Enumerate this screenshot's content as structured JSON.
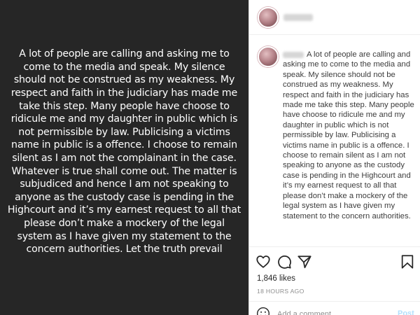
{
  "post_image": {
    "text": "A lot of people are calling and asking me to come to the media and speak. My silence should not be construed as my weakness. My respect and faith in the judiciary has made me take this step. Many people have choose to ridicule me and my daughter in public which is not permissible by law. Publicising a victims name in public is a offence. I choose to remain silent as I am not  the complainant in the case. Whatever is true shall come out. The matter is subjudiced and hence I am not speaking to anyone as the custody case is pending in the Highcourt and it’s my earnest request to all that please don’t make a mockery of the legal system as I have given my statement to the concern authorities. Let the truth prevail"
  },
  "caption": {
    "text": "A lot of people are calling and asking me to come to the media and speak. My silence should not be construed as my weakness. My respect and faith in the judiciary has made me take this step. Many people have choose to ridicule me and my daughter in public which is not permissible by law. Publicising a victims name in public is a offence. I choose to remain silent as I am not speaking to anyone as the custody case is pending in the Highcourt and it’s my earnest request to all that please don’t make a mockery of the legal system as I have given my statement to the concern authorities."
  },
  "actions": {
    "icons": [
      "heart-icon",
      "comment-icon",
      "share-icon",
      "bookmark-icon"
    ],
    "likes": "1,846 likes",
    "time": "18 HOURS AGO"
  },
  "comment_bar": {
    "placeholder": "Add a comment...",
    "post_label": "Post"
  }
}
